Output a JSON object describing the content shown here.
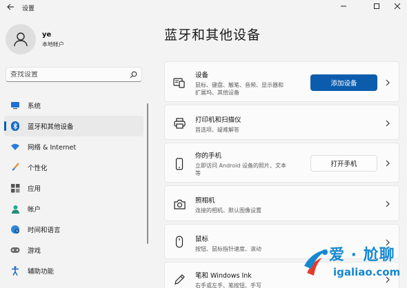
{
  "window": {
    "title": "设置"
  },
  "profile": {
    "name": "ye",
    "account_type": "本地帐户"
  },
  "search": {
    "placeholder": "查找设置"
  },
  "sidebar": {
    "items": [
      {
        "label": "系统",
        "icon": "monitor-icon",
        "active": false
      },
      {
        "label": "蓝牙和其他设备",
        "icon": "bluetooth-icon",
        "active": true
      },
      {
        "label": "网络 & Internet",
        "icon": "wifi-icon",
        "active": false
      },
      {
        "label": "个性化",
        "icon": "brush-icon",
        "active": false
      },
      {
        "label": "应用",
        "icon": "apps-icon",
        "active": false
      },
      {
        "label": "帐户",
        "icon": "person-icon",
        "active": false
      },
      {
        "label": "时间和语言",
        "icon": "globe-clock-icon",
        "active": false
      },
      {
        "label": "游戏",
        "icon": "gamepad-icon",
        "active": false
      },
      {
        "label": "辅助功能",
        "icon": "accessibility-icon",
        "active": false
      }
    ]
  },
  "main": {
    "title": "蓝牙和其他设备",
    "cards": [
      {
        "title": "设备",
        "desc_line1": "鼠标、键盘、触笔、音频、显示器和",
        "desc_line2": "扩展坞、其他设备",
        "button": "添加设备",
        "icon": "devices-icon"
      },
      {
        "title": "打印机和扫描仪",
        "desc_line1": "首选项、疑难解答",
        "icon": "printer-icon"
      },
      {
        "title": "你的手机",
        "desc_line1": "立即访问 Android 设备的照片、文本",
        "desc_line2": "等",
        "button": "打开手机",
        "icon": "phone-icon"
      },
      {
        "title": "照相机",
        "desc_line1": "连接的相机、默认图像设置",
        "icon": "camera-icon"
      },
      {
        "title": "鼠标",
        "desc_line1": "按钮、鼠标指针速度、滚动",
        "icon": "mouse-icon"
      },
      {
        "title": "笔和 Windows Ink",
        "desc_line1": "右手或左手、笔按钮、手写",
        "icon": "pen-icon"
      }
    ]
  },
  "watermark": {
    "brand": "爱 · 尬聊",
    "url": "igaliao.com"
  },
  "colors": {
    "accent": "#005fb8",
    "primary_button": "#0b5cad",
    "watermark": "#1688d2"
  }
}
